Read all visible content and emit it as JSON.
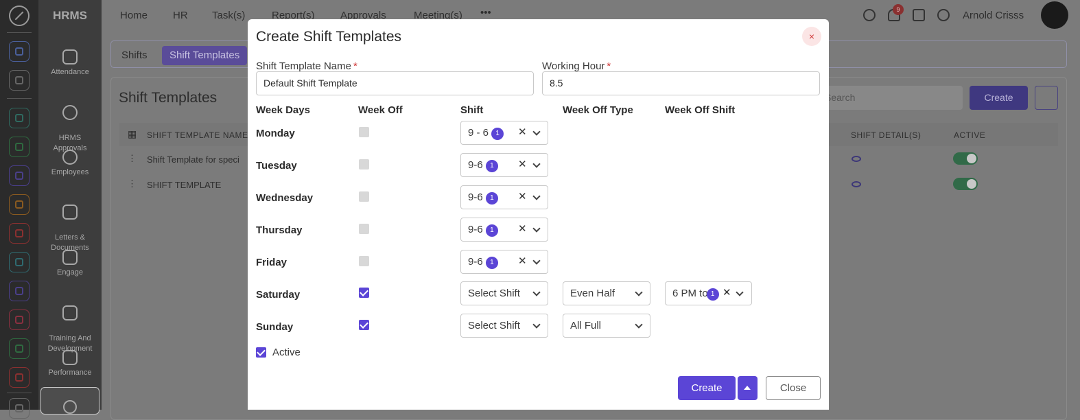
{
  "app": {
    "brand": "HRMS"
  },
  "top_menu": [
    "Home",
    "HR",
    "Task(s)",
    "Report(s)",
    "Approvals",
    "Meeting(s)",
    "•••"
  ],
  "header": {
    "notification_count": "9",
    "user_name": "Arnold Crisss"
  },
  "left_nav": [
    {
      "label": "Attendance"
    },
    {
      "label": "HRMS\nApprovals"
    },
    {
      "label": "Employees"
    },
    {
      "label": "Letters &\nDocuments"
    },
    {
      "label": "Engage"
    },
    {
      "label": "Training And\nDevelopment"
    },
    {
      "label": "Performance"
    }
  ],
  "background_page": {
    "tabs": [
      "Shifts",
      "Shift Templates"
    ],
    "title": "Shift Templates",
    "search_placeholder": "Search",
    "create_label": "Create",
    "columns": [
      "SHIFT TEMPLATE NAME",
      "SHIFT DETAIL(S)",
      "ACTIVE"
    ],
    "rows": [
      {
        "name": "Shift Template for speci",
        "active": true
      },
      {
        "name": "SHIFT TEMPLATE",
        "active": true
      }
    ]
  },
  "modal": {
    "title": "Create Shift Templates",
    "close_icon": "×",
    "fields": {
      "name_label": "Shift Template Name",
      "name_value": "Default Shift Template",
      "hours_label": "Working Hour",
      "hours_value": "8.5",
      "required_mark": "*"
    },
    "columns": [
      "Week Days",
      "Week Off",
      "Shift",
      "Week Off Type",
      "Week Off Shift"
    ],
    "days": [
      {
        "day": "Monday",
        "week_off": false,
        "shift": "9 - 6",
        "shift_count": "1"
      },
      {
        "day": "Tuesday",
        "week_off": false,
        "shift": "9-6",
        "shift_count": "1"
      },
      {
        "day": "Wednesday",
        "week_off": false,
        "shift": "9-6",
        "shift_count": "1"
      },
      {
        "day": "Thursday",
        "week_off": false,
        "shift": "9-6",
        "shift_count": "1"
      },
      {
        "day": "Friday",
        "week_off": false,
        "shift": "9-6",
        "shift_count": "1"
      },
      {
        "day": "Saturday",
        "week_off": true,
        "shift": "Select Shift",
        "week_off_type": "Even Half",
        "week_off_shift": "6 PM to",
        "week_off_shift_count": "1"
      },
      {
        "day": "Sunday",
        "week_off": true,
        "shift": "Select Shift",
        "week_off_type": "All Full"
      }
    ],
    "active_label": "Active",
    "active_checked": true,
    "create_label": "Create",
    "close_label": "Close"
  },
  "colors": {
    "accent": "#5b45d6",
    "danger": "#d03a3a",
    "overlay": "#7b7b7b"
  }
}
